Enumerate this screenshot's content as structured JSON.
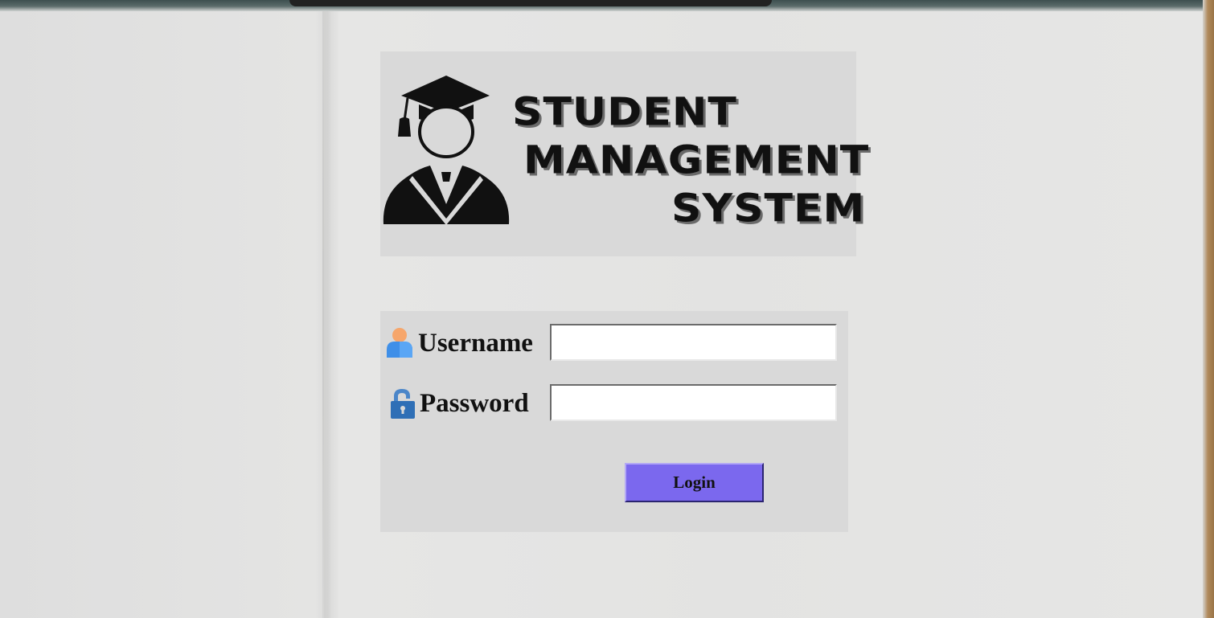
{
  "logo": {
    "icon": "graduate-icon",
    "line1": "STUDENT",
    "line2": "MANAGEMENT",
    "line3": "SYSTEM"
  },
  "login": {
    "username": {
      "icon": "user-icon",
      "label": "Username",
      "value": ""
    },
    "password": {
      "icon": "lock-icon",
      "label": "Password",
      "value": ""
    },
    "button_label": "Login"
  },
  "colors": {
    "panel": "#d9d9d9",
    "button": "#7b68ee",
    "user_icon_head": "#f6a66b",
    "user_icon_body": "#3f8fe8",
    "lock_icon": "#2f6fb6"
  }
}
